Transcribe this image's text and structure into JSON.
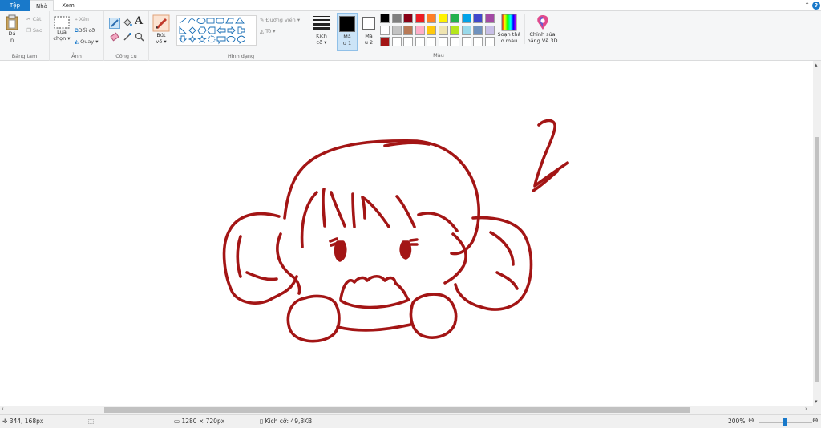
{
  "tabs": {
    "file": "Tệp",
    "home": "Nhà",
    "view": "Xem"
  },
  "clipboard": {
    "paste_line1": "Dá",
    "paste_line2": "n",
    "cut": "Cắt",
    "copy": "Sao",
    "label": "Bảng tạm"
  },
  "image": {
    "select_line1": "Lựa",
    "select_line2": "chọn",
    "crop": "Xén",
    "resize": "Đổi cỡ",
    "rotate": "Quay",
    "label": "Ảnh"
  },
  "tools": {
    "label": "Công cụ",
    "text_glyph": "A"
  },
  "brushes": {
    "line1": "Bút",
    "line2": "vẽ"
  },
  "shapes": {
    "outline": "Đường viền",
    "fill": "Tô",
    "label": "Hình dạng"
  },
  "size": {
    "line1": "Kích",
    "line2": "cỡ"
  },
  "color1": {
    "line1": "Mà",
    "line2": "u 1",
    "value": "#000000"
  },
  "color2": {
    "line1": "Mà",
    "line2": "u 2",
    "value": "#ffffff"
  },
  "palette": {
    "row1": [
      "#000000",
      "#7f7f7f",
      "#880015",
      "#ed1c24",
      "#ff7f27",
      "#fff200",
      "#22b14c",
      "#00a2e8",
      "#3f48cc",
      "#a349a4"
    ],
    "row2": [
      "#ffffff",
      "#c3c3c3",
      "#b97a57",
      "#ffaec9",
      "#ffc90e",
      "#efe4b0",
      "#b5e61d",
      "#99d9ea",
      "#7092be",
      "#c8bfe7"
    ],
    "row3": [
      "#a31515",
      "#ffffff",
      "#ffffff",
      "#ffffff",
      "#ffffff",
      "#ffffff",
      "#ffffff",
      "#ffffff",
      "#ffffff",
      "#ffffff"
    ],
    "label": "Màu"
  },
  "edit_colors": {
    "line1": "Soạn thả",
    "line2": "o màu"
  },
  "paint3d": {
    "line1": "Chỉnh sửa",
    "line2": "bằng Vẽ 3D"
  },
  "drawing_color": "#a31515",
  "status": {
    "cursor": "344, 168px",
    "dimensions": "1280 × 720px",
    "filesize": "Kích cỡ: 49,8KB",
    "zoom": "200%"
  },
  "icons": [
    "paste-icon",
    "cut-icon",
    "copy-icon",
    "select-icon",
    "crop-icon",
    "resize-icon",
    "rotate-icon",
    "pencil-icon",
    "fill-icon",
    "text-icon",
    "eraser-icon",
    "picker-icon",
    "magnifier-icon",
    "brush-icon",
    "size-icon",
    "edit-colors-icon",
    "paint3d-icon",
    "cursor-pos-icon",
    "selection-size-icon",
    "image-size-icon",
    "filesize-icon",
    "zoom-out-icon",
    "zoom-in-icon"
  ]
}
